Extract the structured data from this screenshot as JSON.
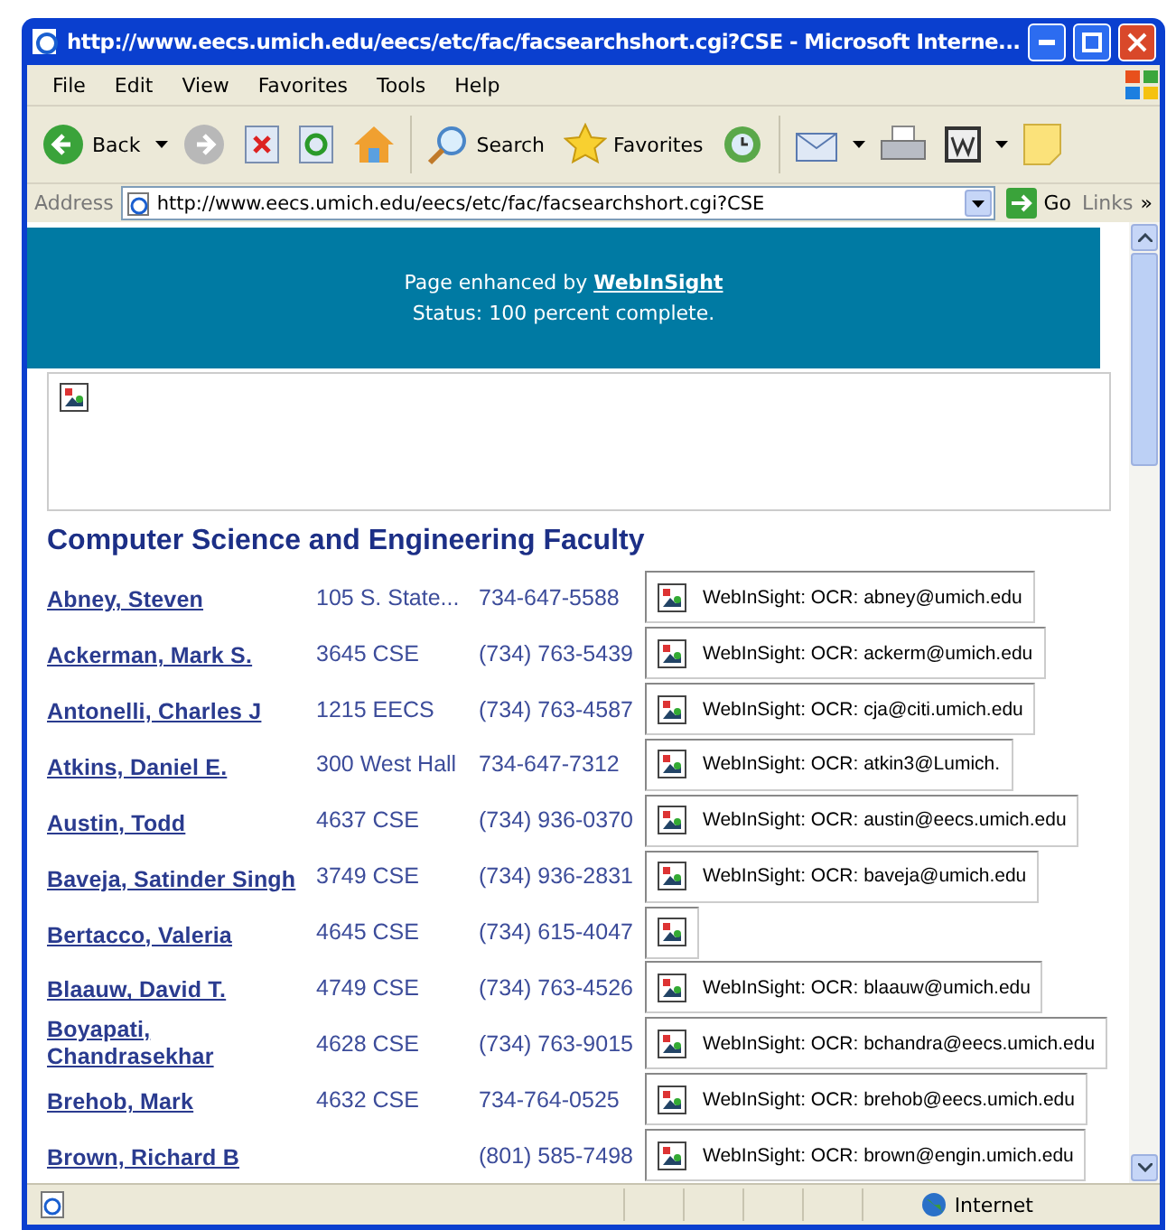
{
  "window": {
    "title": "http://www.eecs.umich.edu/eecs/etc/fac/facsearchshort.cgi?CSE - Microsoft Interne..."
  },
  "menu": [
    "File",
    "Edit",
    "View",
    "Favorites",
    "Tools",
    "Help"
  ],
  "toolbar": {
    "back": "Back",
    "search": "Search",
    "favorites": "Favorites"
  },
  "address_bar": {
    "label": "Address",
    "value": "http://www.eecs.umich.edu/eecs/etc/fac/facsearchshort.cgi?CSE",
    "go": "Go",
    "links": "Links",
    "more": "»"
  },
  "banner": {
    "text": "Page enhanced by",
    "link": "WebInSight",
    "status": "Status: 100 percent complete."
  },
  "heading": "Computer Science and Engineering Faculty",
  "rows": [
    {
      "name": "Abney, Steven",
      "room": "105 S. State...",
      "phone": "734-647-5588",
      "ocr": "WebInSight: OCR: abney@umich.edu"
    },
    {
      "name": "Ackerman, Mark S.",
      "room": "3645 CSE",
      "phone": "(734) 763-5439",
      "ocr": "WebInSight: OCR: ackerm@umich.edu"
    },
    {
      "name": "Antonelli, Charles J",
      "room": "1215 EECS",
      "phone": "(734) 763-4587",
      "ocr": "WebInSight: OCR: cja@citi.umich.edu"
    },
    {
      "name": "Atkins, Daniel E.",
      "room": "300 West Hall",
      "phone": "734-647-7312",
      "ocr": "WebInSight: OCR: atkin3@Lumich."
    },
    {
      "name": "Austin, Todd",
      "room": "4637 CSE",
      "phone": "(734) 936-0370",
      "ocr": "WebInSight: OCR: austin@eecs.umich.edu"
    },
    {
      "name": "Baveja, Satinder Singh",
      "room": "3749 CSE",
      "phone": "(734) 936-2831",
      "ocr": "WebInSight: OCR: baveja@umich.edu"
    },
    {
      "name": "Bertacco, Valeria",
      "room": "4645 CSE",
      "phone": "(734) 615-4047"
    },
    {
      "name": "Blaauw, David T.",
      "room": "4749 CSE",
      "phone": "(734) 763-4526",
      "ocr": "WebInSight: OCR: blaauw@umich.edu"
    },
    {
      "name": "Boyapati, Chandrasekhar",
      "room": "4628 CSE",
      "phone": "(734) 763-9015",
      "ocr": "WebInSight: OCR: bchandra@eecs.umich.edu"
    },
    {
      "name": "Brehob, Mark",
      "room": "4632 CSE",
      "phone": "734-764-0525",
      "ocr": "WebInSight: OCR: brehob@eecs.umich.edu"
    },
    {
      "name": "Brown, Richard B",
      "phone": "(801) 585-7498",
      "ocr": "WebInSight: OCR: brown@engin.umich.edu"
    }
  ],
  "status_bar": {
    "zone": "Internet"
  }
}
